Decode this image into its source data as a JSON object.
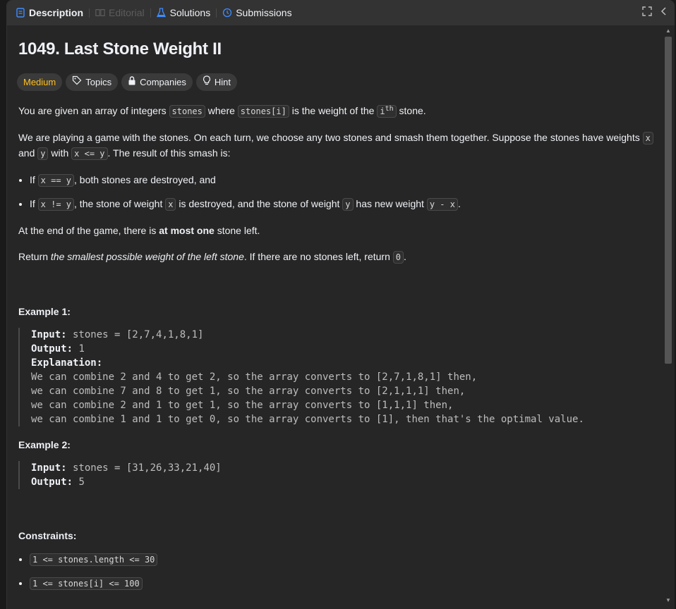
{
  "tabs": [
    {
      "label": "Description",
      "state": "active",
      "icon": "document-icon"
    },
    {
      "label": "Editorial",
      "state": "disabled",
      "icon": "book-icon"
    },
    {
      "label": "Solutions",
      "state": "normal",
      "icon": "flask-icon"
    },
    {
      "label": "Submissions",
      "state": "normal",
      "icon": "history-icon"
    }
  ],
  "problem": {
    "title": "1049. Last Stone Weight II",
    "tags": [
      {
        "label": "Medium",
        "icon": ""
      },
      {
        "label": "Topics",
        "icon": "tag-icon"
      },
      {
        "label": "Companies",
        "icon": "lock-icon"
      },
      {
        "label": "Hint",
        "icon": "bulb-icon"
      }
    ],
    "p1": {
      "a": "You are given an array of integers ",
      "c1": "stones",
      "b": " where ",
      "c2": "stones[i]",
      "c": " is the weight of the ",
      "c3": "i",
      "sup": "th",
      "d": " stone."
    },
    "p2": {
      "a": "We are playing a game with the stones. On each turn, we choose any two stones and smash them together. Suppose the stones have weights ",
      "c1": "x",
      "b": " and ",
      "c2": "y",
      "c": " with ",
      "c3": "x <= y",
      "d": ". The result of this smash is:"
    },
    "li1": {
      "a": "If ",
      "c1": "x == y",
      "b": ", both stones are destroyed, and"
    },
    "li2": {
      "a": "If ",
      "c1": "x != y",
      "b": ", the stone of weight ",
      "c2": "x",
      "c": " is destroyed, and the stone of weight ",
      "c3": "y",
      "d": " has new weight ",
      "c4": "y - x",
      "e": "."
    },
    "p3": {
      "a": "At the end of the game, there is ",
      "bold": "at most one",
      "b": " stone left."
    },
    "p4": {
      "a": "Return ",
      "em": "the smallest possible weight of the left stone",
      "b": ". If there are no stones left, return ",
      "c1": "0",
      "c": "."
    },
    "example1": {
      "title": "Example 1:",
      "input_label": "Input:",
      "input": " stones = [2,7,4,1,8,1]",
      "output_label": "Output:",
      "output": " 1",
      "explanation_label": "Explanation:",
      "lines": [
        "We can combine 2 and 4 to get 2, so the array converts to [2,7,1,8,1] then,",
        "we can combine 7 and 8 to get 1, so the array converts to [2,1,1,1] then,",
        "we can combine 2 and 1 to get 1, so the array converts to [1,1,1] then,",
        "we can combine 1 and 1 to get 0, so the array converts to [1], then that's the optimal value."
      ]
    },
    "example2": {
      "title": "Example 2:",
      "input_label": "Input:",
      "input": " stones = [31,26,33,21,40]",
      "output_label": "Output:",
      "output": " 5"
    },
    "constraints": {
      "title": "Constraints:",
      "items": [
        "1 <= stones.length <= 30",
        "1 <= stones[i] <= 100"
      ]
    }
  }
}
